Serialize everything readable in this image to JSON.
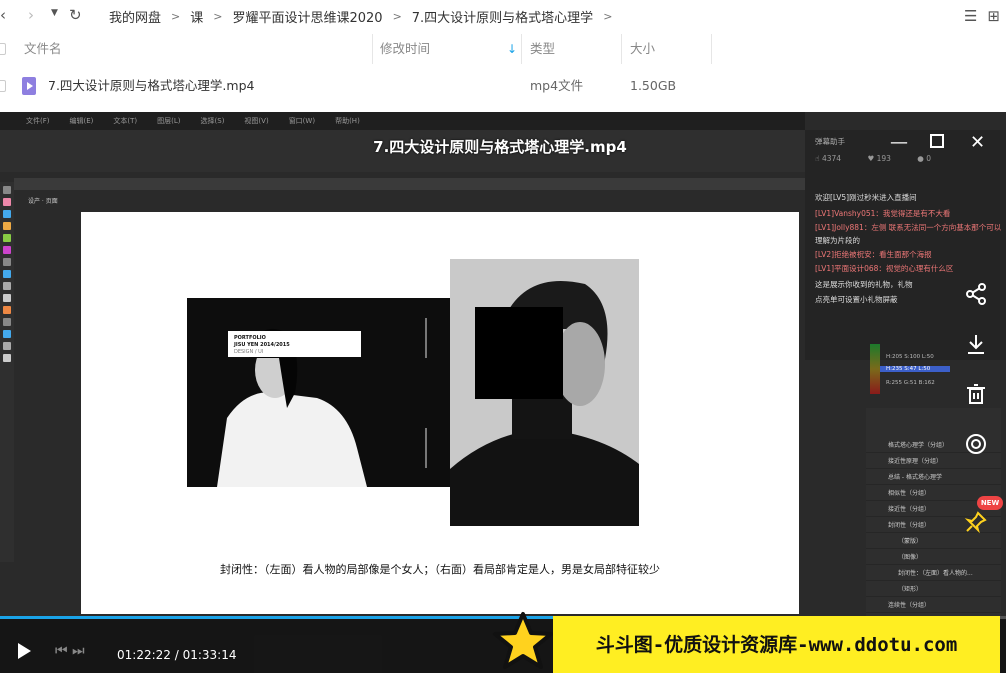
{
  "breadcrumb": {
    "items": [
      "我的网盘",
      "课",
      "罗耀平面设计思维课2020",
      "7.四大设计原则与格式塔心理学"
    ],
    "separator": ">"
  },
  "table": {
    "columns": [
      "文件名",
      "修改时间",
      "类型",
      "大小"
    ],
    "rows": [
      {
        "name": "7.四大设计原则与格式塔心理学.mp4",
        "type": "mp4文件",
        "size": "1.50GB"
      }
    ]
  },
  "player": {
    "title": "7.四大设计原则与格式塔心理学.mp4",
    "caption": "封闭性：（左面）看人物的局部像是个女人；（右面）看局部肯定是人，男是女局部特征较少",
    "portfolio_lines": [
      "PORTFOLIO",
      "JISU YEN 2014/2015",
      "DESIGN / UI"
    ],
    "time": "01:22:22 / 01:33:14",
    "progress": 0.883,
    "watermark": "斗斗图-优质设计资源库-www.ddotu.com",
    "new_badge": "NEW",
    "danmaku_title": "弹幕助手",
    "danmaku_stats": [
      "4374",
      "193",
      "0"
    ],
    "danmaku_lines": [
      "欢迎[LV5]刚过秒米进入直播间",
      "[LV1]Vanshy051：我觉得还是有不大看",
      "[LV1]Jolly881：左侧 联系无法同一个方向基本那个可以",
      "理解为片段的",
      "[LV2]拒绝被祝安：看生面那个海报",
      "[LV1]平面设计068：视觉的心理有什么区",
      "这是展示你收到的礼物，礼物",
      "点亮单可设置小礼物屏蔽"
    ],
    "layers": [
      "格式塔心理学（分组）",
      "接近性原理（分组）",
      "总结 - 格式塔心理学",
      "相似性（分组）",
      "接近性（分组）",
      "封闭性（分组）",
      "（蒙版）",
      "（图像）",
      "封闭性：（左面）看人物的...",
      "（矩形）",
      "连续性（分组）"
    ],
    "colors": [
      "H:205 S:100 L:50",
      "H:235 S:47 L:50",
      "R:255 G:51 B:162"
    ],
    "accent": "#1aa3e8"
  }
}
